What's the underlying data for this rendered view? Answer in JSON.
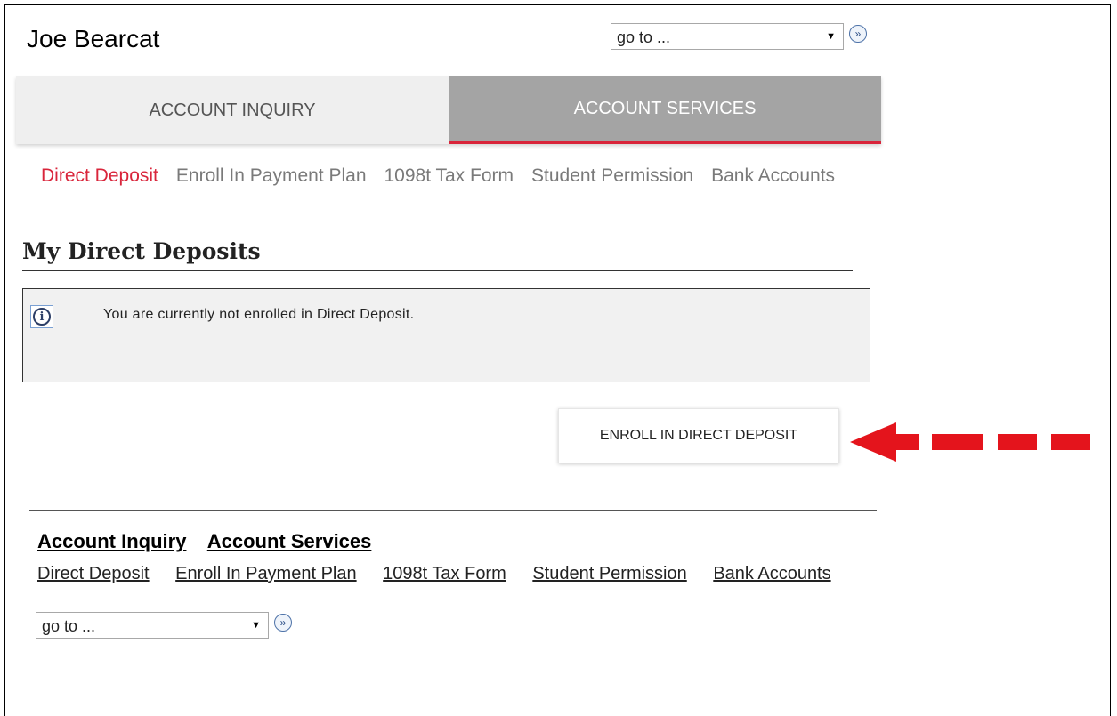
{
  "header": {
    "user_name": "Joe Bearcat",
    "goto": {
      "value": "go to ...",
      "caret": "▼",
      "go": "»"
    }
  },
  "tabs": [
    {
      "label": "ACCOUNT INQUIRY",
      "active": false
    },
    {
      "label": "ACCOUNT SERVICES",
      "active": true
    }
  ],
  "subnav": [
    {
      "label": "Direct Deposit",
      "active": true
    },
    {
      "label": "Enroll In Payment Plan",
      "active": false
    },
    {
      "label": "1098t Tax Form",
      "active": false
    },
    {
      "label": "Student Permission",
      "active": false
    },
    {
      "label": "Bank Accounts",
      "active": false
    }
  ],
  "main": {
    "title": "My Direct Deposits",
    "info": {
      "icon": "i",
      "message": "You are currently not enrolled in Direct Deposit."
    },
    "enroll_button": "ENROLL IN DIRECT DEPOSIT"
  },
  "footer": {
    "main_links": [
      "Account Inquiry",
      "Account Services"
    ],
    "sub_links": [
      "Direct Deposit",
      "Enroll In Payment Plan",
      "1098t Tax Form",
      "Student Permission",
      "Bank Accounts"
    ],
    "goto": {
      "value": "go to ...",
      "caret": "▼",
      "go": "»"
    }
  },
  "colors": {
    "accent_red": "#d9253b",
    "active_tab_bg": "#a4a4a4",
    "inactive_tab_bg": "#efefef",
    "annotation_arrow": "#e4141c"
  },
  "icons": [
    "chevron-down-icon",
    "double-chevron-right-icon",
    "info-icon",
    "arrow-left-icon"
  ]
}
